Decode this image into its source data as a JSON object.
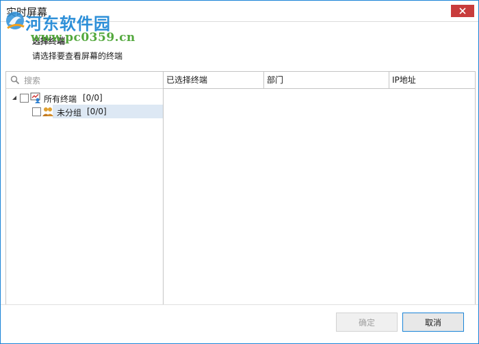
{
  "window": {
    "title": "实时屏幕",
    "accent_color": "#1883d7",
    "close_color": "#c83c3c"
  },
  "watermark": {
    "site_name": "河东软件园",
    "url": "www.pc0359.cn"
  },
  "header": {
    "title": "选择终端",
    "subtitle": "请选择要查看屏幕的终端"
  },
  "search": {
    "placeholder": "搜索",
    "value": ""
  },
  "tree": {
    "nodes": [
      {
        "label": "所有终端",
        "count": "[0/0]",
        "expanded": true,
        "checked": false,
        "icon": "terminal-group-icon"
      },
      {
        "label": "未分组",
        "count": "[0/0]",
        "checked": false,
        "selected": true,
        "icon": "users-group-icon"
      }
    ]
  },
  "table": {
    "columns": [
      "已选择终端",
      "部门",
      "IP地址"
    ],
    "rows": []
  },
  "buttons": {
    "ok_label": "确定",
    "ok_enabled": false,
    "cancel_label": "取消"
  }
}
